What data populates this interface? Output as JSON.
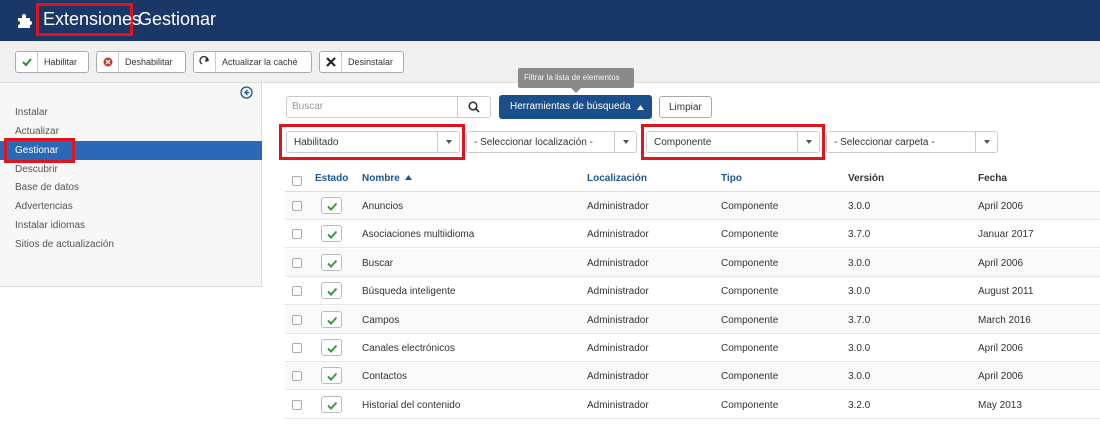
{
  "header": {
    "title_primary": "Extensiones",
    "title_secondary": "Gestionar",
    "icon": "puzzle-icon"
  },
  "toolbar": {
    "enable": "Habilitar",
    "disable": "Deshabilitar",
    "refresh": "Actualizar la caché",
    "uninstall": "Desinstalar"
  },
  "sidebar": {
    "items": [
      "Instalar",
      "Actualizar",
      "Gestionar",
      "Descubrir",
      "Base de datos",
      "Advertencias",
      "Instalar idiomas",
      "Sitios de actualización"
    ],
    "active_index": 2
  },
  "filters": {
    "search_placeholder": "Buscar",
    "tools_label": "Herramientas de búsqueda",
    "clear_label": "Limpiar",
    "tooltip": "Filtrar la lista de elementos",
    "status": "Habilitado",
    "location": "- Seleccionar localización -",
    "type": "Componente",
    "folder": "- Seleccionar carpeta -"
  },
  "table": {
    "headers": {
      "state": "Estado",
      "name": "Nombre",
      "location": "Localización",
      "type": "Tipo",
      "version": "Versión",
      "date": "Fecha"
    },
    "rows": [
      {
        "name": "Anuncios",
        "location": "Administrador",
        "type": "Componente",
        "version": "3.0.0",
        "date": "April 2006"
      },
      {
        "name": "Asociaciones multiidioma",
        "location": "Administrador",
        "type": "Componente",
        "version": "3.7.0",
        "date": "Januar 2017"
      },
      {
        "name": "Buscar",
        "location": "Administrador",
        "type": "Componente",
        "version": "3.0.0",
        "date": "April 2006"
      },
      {
        "name": "Búsqueda inteligente",
        "location": "Administrador",
        "type": "Componente",
        "version": "3.0.0",
        "date": "August 2011"
      },
      {
        "name": "Campos",
        "location": "Administrador",
        "type": "Componente",
        "version": "3.7.0",
        "date": "March 2016"
      },
      {
        "name": "Canales electrónicos",
        "location": "Administrador",
        "type": "Componente",
        "version": "3.0.0",
        "date": "April 2006"
      },
      {
        "name": "Contactos",
        "location": "Administrador",
        "type": "Componente",
        "version": "3.0.0",
        "date": "April 2006"
      },
      {
        "name": "Historial del contenido",
        "location": "Administrador",
        "type": "Componente",
        "version": "3.2.0",
        "date": "May 2013"
      }
    ]
  },
  "colors": {
    "header_bg": "#1a3867",
    "accent": "#2a69b8",
    "highlight": "#e0141e",
    "enabled_check": "#3c9a3c"
  }
}
